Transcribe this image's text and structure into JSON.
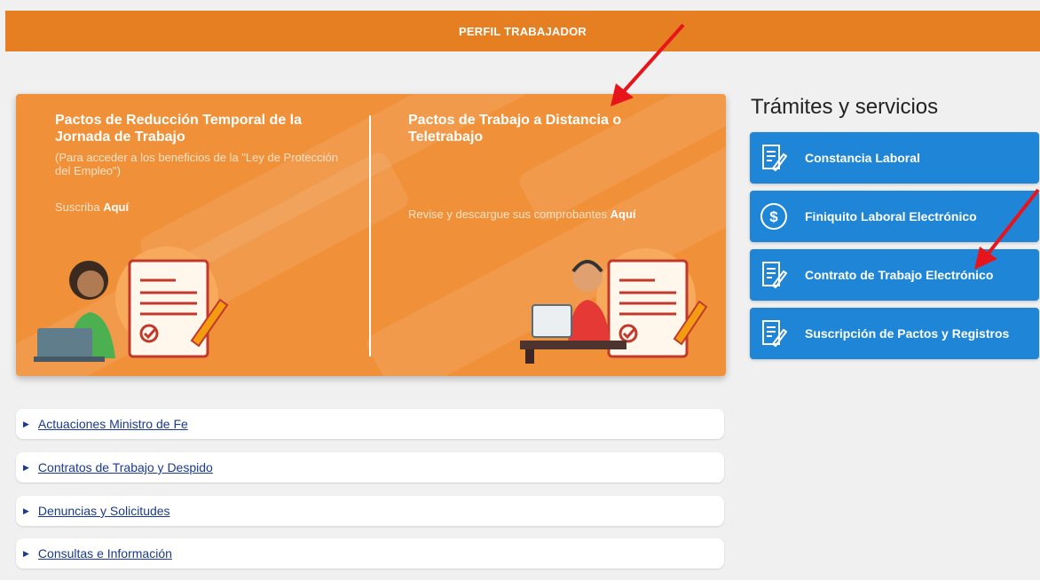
{
  "header": {
    "title": "PERFIL TRABAJADOR"
  },
  "banner": {
    "left": {
      "title": "Pactos de Reducción Temporal de la Jornada de Trabajo",
      "subtitle": "(Para acceder a los beneficios de la \"Ley de Protección del Empleo\")",
      "cta_text": "Suscriba ",
      "cta_link": "Aquí"
    },
    "right": {
      "title": "Pactos de Trabajo a Distancia o Teletrabajo",
      "cta_text": "Revise y descargue sus comprobantes ",
      "cta_link": "Aquí"
    }
  },
  "services": {
    "title": "Trámites y servicios",
    "items": [
      {
        "label": "Constancia Laboral",
        "icon": "document-pen-icon"
      },
      {
        "label": "Finiquito Laboral Electrónico",
        "icon": "dollar-circle-icon"
      },
      {
        "label": "Contrato de Trabajo Electrónico",
        "icon": "document-pen-icon"
      },
      {
        "label": "Suscripción de Pactos y Registros",
        "icon": "document-pen-icon"
      }
    ]
  },
  "accordion": {
    "items": [
      {
        "label": "Actuaciones Ministro de Fe"
      },
      {
        "label": "Contratos de Trabajo y Despido"
      },
      {
        "label": "Denuncias y Solicitudes"
      },
      {
        "label": "Consultas e Información"
      }
    ]
  },
  "colors": {
    "header": "#e67e22",
    "banner": "#f0913a",
    "service_button": "#1f85d6",
    "link": "#1a3a8f",
    "arrow": "#e8141c"
  }
}
